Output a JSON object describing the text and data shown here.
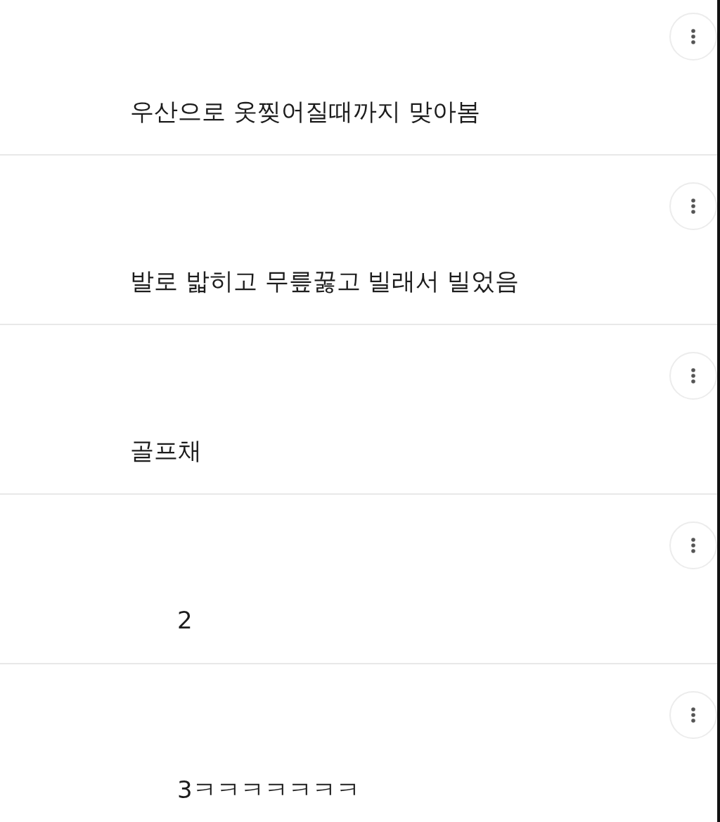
{
  "comments": [
    {
      "kind": "comment",
      "text": "우산으로 옷찢어질때까지 맞아봄"
    },
    {
      "kind": "comment",
      "text": "발로 밟히고 무릎꿇고 빌래서 빌었음"
    },
    {
      "kind": "comment",
      "text": "골프채"
    },
    {
      "kind": "reply",
      "text": "2"
    },
    {
      "kind": "reply",
      "text": "3ㅋㅋㅋㅋㅋㅋㅋ"
    }
  ]
}
